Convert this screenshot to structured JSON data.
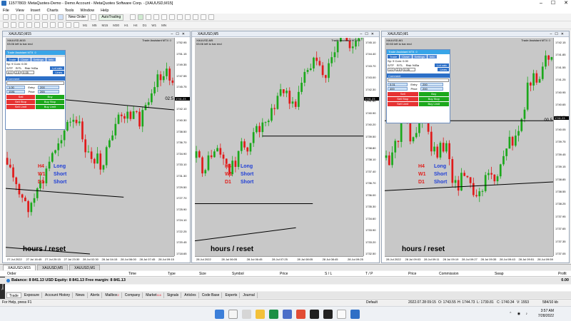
{
  "app": {
    "title": "11577803: MetaQuotes-Demo - Demo Account - MetaQuotes Software Corp. - [XAUUSD,M15]",
    "window_buttons": [
      "–",
      "☐",
      "✕"
    ]
  },
  "menu": [
    "File",
    "View",
    "Insert",
    "Charts",
    "Tools",
    "Window",
    "Help"
  ],
  "toolbar": {
    "new_order": "New Order",
    "autotrading": "AutoTrading",
    "timeframes": [
      "M1",
      "M5",
      "M15",
      "M30",
      "H1",
      "H4",
      "D1",
      "W1",
      "MN"
    ]
  },
  "charts": [
    {
      "title": "XAUUSD,M15",
      "symbol": "XAUUSD,M15",
      "countdown": "03:06 left to bar end",
      "ea": "Trade Assistant MT4 ☺",
      "last_price": "02:5",
      "price_box": "1741.23",
      "y_ticks": [
        "1752.95",
        "1751.15",
        "1749.35",
        "1747.55",
        "1745.75",
        "1743.95",
        "1742.10",
        "1740.30",
        "1738.50",
        "1736.70",
        "1734.90",
        "1733.10",
        "1731.30",
        "1729.50",
        "1727.70",
        "1725.90",
        "1724.10",
        "1722.25",
        "1720.45",
        "1718.65"
      ],
      "x_ticks": [
        "27 Jul 2022",
        "27 Jul 16:45",
        "27 Jul 20:15",
        "27 Jul 23:30",
        "28 Jul 02:30",
        "28 Jul 04:15",
        "28 Jul 06:00",
        "28 Jul 07:45",
        "28 Jul 09:15"
      ],
      "tf_rows": [
        {
          "tf": "H4",
          "dir": "Long"
        },
        {
          "tf": "W1",
          "dir": "Short"
        },
        {
          "tf": "D1",
          "dir": "Short"
        }
      ],
      "footer": "hours / reset"
    },
    {
      "title": "XAUUSD,M5",
      "symbol": "XAUUSD,M5",
      "countdown": "03:06 left to bar end",
      "ea": "Trade Assistant MT4 ☺",
      "last_price": "",
      "price_box": "1741.23",
      "y_ticks": [
        "1745.10",
        "1744.40",
        "1743.70",
        "1743.00",
        "1742.30",
        "1741.60",
        "1740.90",
        "1740.20",
        "1739.50",
        "1738.80",
        "1738.10",
        "1737.40",
        "1736.70",
        "1736.00",
        "1735.30",
        "1734.60",
        "1733.90",
        "1733.20",
        "1732.50"
      ],
      "x_ticks": [
        "28 Jul 2022",
        "28 Jul 06:05",
        "28 Jul 06:45",
        "28 Jul 07:25",
        "28 Jul 08:05",
        "28 Jul 08:45",
        "28 Jul 09:25"
      ],
      "tf_rows": [
        {
          "tf": "H4",
          "dir": "Long"
        },
        {
          "tf": "W1",
          "dir": "Short"
        },
        {
          "tf": "D1",
          "dir": "Short"
        }
      ],
      "footer": "hours / reset"
    },
    {
      "title": "XAUUSD,M1",
      "symbol": "XAUUSD,M1",
      "countdown": "00:53 left to bar end",
      "ea": "Trade Assistant MT4 ☺",
      "last_price": "00.5",
      "price_box": "1741.23",
      "y_ticks": [
        "1742.15",
        "1741.85",
        "1741.55",
        "1741.25",
        "1740.95",
        "1740.65",
        "1740.35",
        "1740.05",
        "1739.75",
        "1739.45",
        "1739.15",
        "1738.85",
        "1738.55",
        "1738.25",
        "1737.95",
        "1737.65",
        "1737.35",
        "1737.05"
      ],
      "x_ticks": [
        "28 Jul 2022",
        "28 Jul 09:03",
        "28 Jul 09:11",
        "28 Jul 09:19",
        "28 Jul 09:27",
        "28 Jul 09:35",
        "28 Jul 09:43",
        "28 Jul 09:51",
        "28 Jul 09:59"
      ],
      "tf_rows": [
        {
          "tf": "H4",
          "dir": "Long"
        },
        {
          "tf": "W1",
          "dir": "Short"
        },
        {
          "tf": "D1",
          "dir": "Short"
        }
      ],
      "footer": "hours / reset"
    }
  ],
  "panel_left": {
    "title": "Trade Assistant MT4 ☺",
    "tabs": [
      "Trade",
      "Close",
      "Settings",
      "Info"
    ],
    "spread": "Sp: 9  Com: 0.00",
    "risk_labels": [
      "S/TP",
      "R/TL",
      "Risk %/Ba"
    ],
    "risk_values": [
      "4.0",
      "2.0",
      "0.05"
    ],
    "lot_calc": "Lot calc",
    "lines": "Lines",
    "comment": "Comment",
    "entry_label": "Entry",
    "price_label": "Price",
    "entry_vals": [
      "1.00",
      "200"
    ],
    "price_vals": [
      "1081",
      "265"
    ],
    "sell": "Sell",
    "buy": "Buy",
    "sell_stop": "Sell Stop",
    "buy_stop": "Buy Stop",
    "sell_limit": "Sell Limit",
    "buy_limit": "Buy Limit"
  },
  "panel_right": {
    "title": "Trade Assistant MT4 ☺",
    "tabs": [
      "Trade",
      "Close",
      "Settings",
      "Info"
    ],
    "spread": "Sp: 9  Com: 0.00",
    "risk_labels": [
      "S/TP",
      "R/TL",
      "Risk %/Ba"
    ],
    "risk_values": [
      "1.0",
      "2.0",
      "0.05"
    ],
    "lot_calc": "Lot calc",
    "lines": "Lines",
    "comment": "Comment",
    "entry_label": "Entry",
    "price_label": "Price",
    "entry_vals": [
      "0.01",
      "200"
    ],
    "price_vals": [
      "400",
      "200"
    ],
    "sell": "Sell",
    "buy": "Buy",
    "sell_stop": "Sell Stop",
    "buy_stop": "Buy Stop",
    "sell_limit": "Sell Limit",
    "buy_limit": "Buy Limit"
  },
  "window_tabs": [
    "XAUUSD,M15",
    "XAUUSD,M5",
    "XAUUSD,M1"
  ],
  "terminal": {
    "columns": [
      "Order",
      "Time",
      "Type",
      "Size",
      "Symbol",
      "Price",
      "S / L",
      "T / P",
      "Price",
      "Commission",
      "Swap",
      "Profit"
    ],
    "balance_line": "Balance: 8 841.13 USD  Equity: 8 841.13  Free margin: 8 841.13",
    "balance_value": "0.00",
    "side_label": "Terminal",
    "tabs": [
      {
        "label": "Trade",
        "badge": ""
      },
      {
        "label": "Exposure",
        "badge": ""
      },
      {
        "label": "Account History",
        "badge": ""
      },
      {
        "label": "News",
        "badge": ""
      },
      {
        "label": "Alerts",
        "badge": ""
      },
      {
        "label": "Mailbox",
        "badge": "2"
      },
      {
        "label": "Company",
        "badge": ""
      },
      {
        "label": "Market",
        "badge": "116"
      },
      {
        "label": "Signals",
        "badge": ""
      },
      {
        "label": "Articles",
        "badge": ""
      },
      {
        "label": "Code Base",
        "badge": ""
      },
      {
        "label": "Experts",
        "badge": ""
      },
      {
        "label": "Journal",
        "badge": ""
      }
    ]
  },
  "status": {
    "help": "For Help, press F1",
    "profile": "Default",
    "datetime": "2022.07.28 09:15",
    "open": "O: 1743.55",
    "high": "H: 1744.73",
    "low": "L: 1739.81",
    "close": "C: 1740.34",
    "volume": "V: 1553",
    "traffic": "584/10 kb"
  },
  "clock": {
    "time": "3:57 AM",
    "date": "7/28/2022"
  },
  "colors": {
    "bull": "#1ca81c",
    "bear": "#e01b1b",
    "plot_bg": "#c8c8c8",
    "long": "#1f3fd6",
    "tf_label": "#e0201c"
  }
}
